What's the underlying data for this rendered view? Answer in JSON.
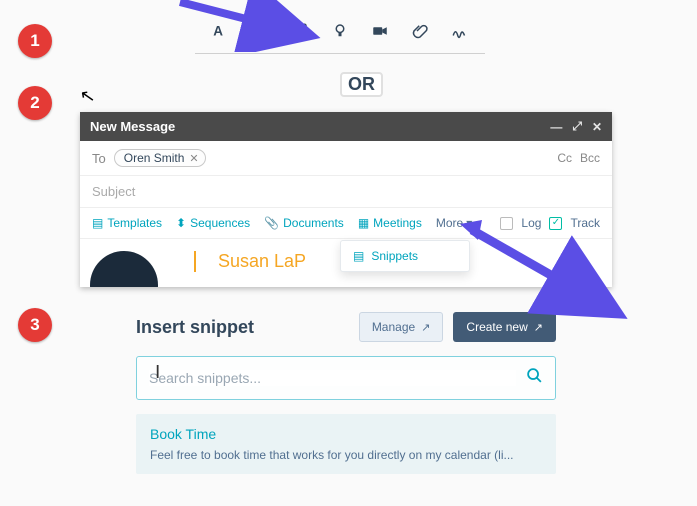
{
  "steps": {
    "one": "1",
    "two": "2",
    "three": "3"
  },
  "or_label": "OR",
  "icon_row": {
    "font": "font-size-icon",
    "tag": "personalization-token-icon",
    "template": "snippets-icon",
    "knowledge": "knowledge-icon",
    "video": "video-icon",
    "attach": "attachment-icon",
    "signature": "signature-icon"
  },
  "compose": {
    "title": "New Message",
    "to_label": "To",
    "recipient": "Oren Smith",
    "cc": "Cc",
    "bcc": "Bcc",
    "subject_placeholder": "Subject",
    "toolbar": {
      "templates": "Templates",
      "sequences": "Sequences",
      "documents": "Documents",
      "meetings": "Meetings",
      "more": "More",
      "log": "Log",
      "track": "Track",
      "track_checked": true
    },
    "dropdown": {
      "snippets": "Snippets"
    },
    "signature_name": "Susan LaP"
  },
  "snippet_panel": {
    "title": "Insert snippet",
    "manage": "Manage",
    "create_new": "Create new",
    "search_placeholder": "Search snippets...",
    "result": {
      "title": "Book Time",
      "body": "Feel free to book time that works for you directly on my calendar (li..."
    }
  }
}
